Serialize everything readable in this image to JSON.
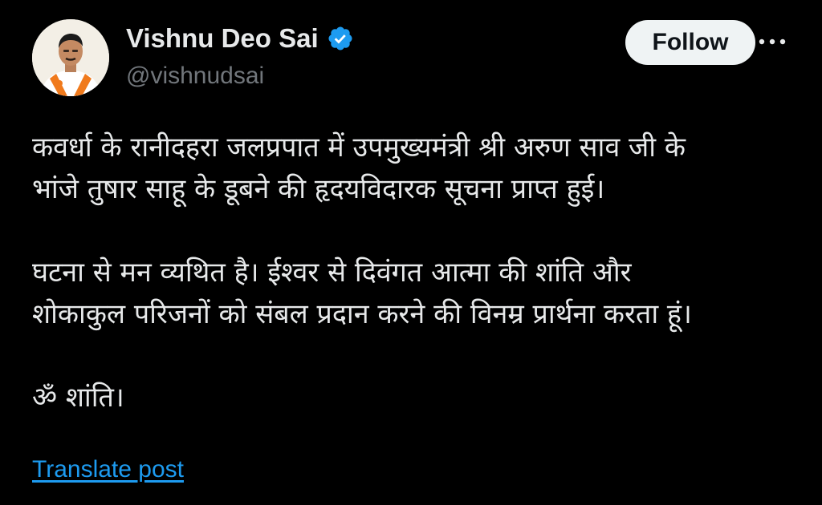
{
  "author": {
    "name": "Vishnu Deo Sai",
    "handle": "@vishnudsai",
    "verified_icon": "verified-badge-icon",
    "avatar_icon": "avatar"
  },
  "actions": {
    "follow_label": "Follow",
    "more_icon": "more-options-icon"
  },
  "post": {
    "paragraphs": [
      "कवर्धा के रानीदहरा जलप्रपात में उपमुख्यमंत्री श्री अरुण साव जी के\nभांजे तुषार साहू के डूबने की हृदयविदारक सूचना प्राप्त हुई।",
      "घटना से मन व्यथित है। ईश्वर से दिवंगत आत्मा की शांति और\nशोकाकुल परिजनों को संबल प्रदान करने की विनम्र प्रार्थना करता हूं।",
      "ॐ शांति।"
    ],
    "translate_label": "Translate post"
  },
  "colors": {
    "background": "#000000",
    "text_primary": "#e7e9ea",
    "text_secondary": "#71767b",
    "accent_blue": "#1d9bf0",
    "follow_button_bg": "#eff3f4"
  }
}
